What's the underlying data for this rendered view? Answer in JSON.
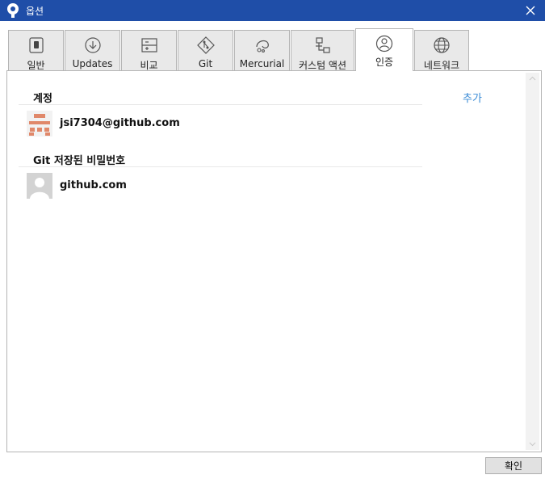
{
  "window": {
    "title": "옵션"
  },
  "tabs": [
    {
      "label": "일반",
      "icon": "switch-icon"
    },
    {
      "label": "Updates",
      "icon": "download-icon"
    },
    {
      "label": "비교",
      "icon": "diff-icon"
    },
    {
      "label": "Git",
      "icon": "git-icon"
    },
    {
      "label": "Mercurial",
      "icon": "mercurial-icon"
    },
    {
      "label": "커스텀 액션",
      "icon": "custom-action-icon"
    },
    {
      "label": "인증",
      "icon": "user-icon",
      "active": true
    },
    {
      "label": "네트워크",
      "icon": "globe-icon"
    }
  ],
  "auth": {
    "accounts_header": "계정",
    "add_label": "추가",
    "accounts": [
      {
        "label": "jsi7304@github.com",
        "icon": "identicon-avatar"
      }
    ],
    "git_passwords_header": "Git 저장된 비밀번호",
    "git_passwords": [
      {
        "label": "github.com",
        "icon": "default-avatar"
      }
    ]
  },
  "footer": {
    "ok_label": "확인"
  },
  "colors": {
    "titlebar": "#1f4ea8",
    "link": "#3a8bd6",
    "identicon": "#e0886a"
  }
}
